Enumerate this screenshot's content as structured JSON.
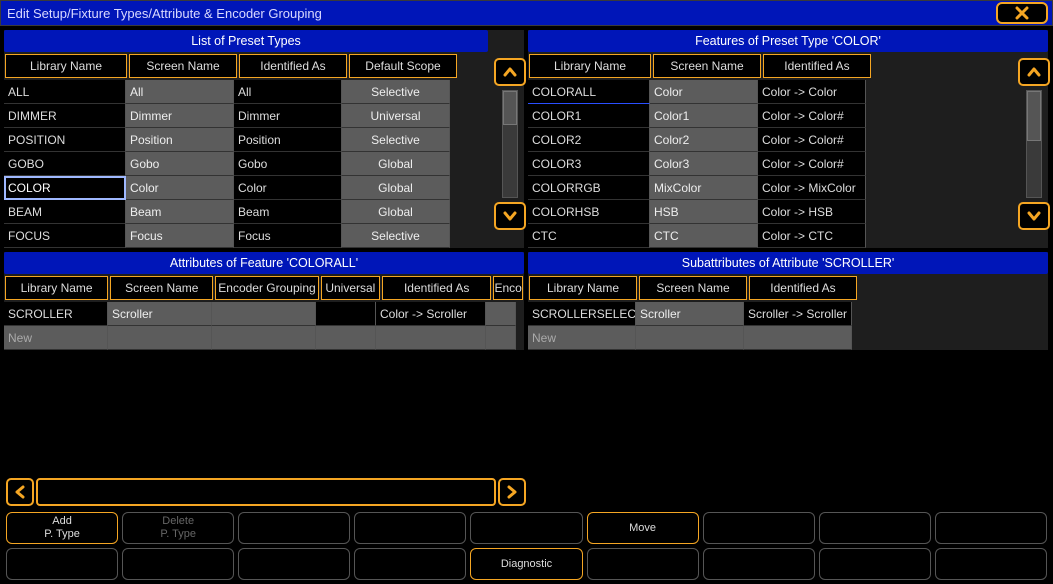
{
  "title": "Edit Setup/Fixture Types/Attribute & Encoder Grouping",
  "panels": {
    "presetTypes": {
      "title": "List of Preset Types",
      "headers": [
        "Library Name",
        "Screen Name",
        "Identified As",
        "Default Scope"
      ],
      "rows": [
        {
          "lib": "ALL",
          "screen": "All",
          "ident": "All",
          "scope": "Selective"
        },
        {
          "lib": "DIMMER",
          "screen": "Dimmer",
          "ident": "Dimmer",
          "scope": "Universal"
        },
        {
          "lib": "POSITION",
          "screen": "Position",
          "ident": "Position",
          "scope": "Selective"
        },
        {
          "lib": "GOBO",
          "screen": "Gobo",
          "ident": "Gobo",
          "scope": "Global"
        },
        {
          "lib": "COLOR",
          "screen": "Color",
          "ident": "Color",
          "scope": "Global"
        },
        {
          "lib": "BEAM",
          "screen": "Beam",
          "ident": "Beam",
          "scope": "Global"
        },
        {
          "lib": "FOCUS",
          "screen": "Focus",
          "ident": "Focus",
          "scope": "Selective"
        }
      ],
      "selectedRow": 4
    },
    "features": {
      "title": "Features of Preset Type 'COLOR'",
      "headers": [
        "Library Name",
        "Screen Name",
        "Identified As"
      ],
      "rows": [
        {
          "lib": "COLORALL",
          "screen": "Color",
          "ident": "Color -> Color"
        },
        {
          "lib": "COLOR1",
          "screen": "Color1",
          "ident": "Color -> Color#"
        },
        {
          "lib": "COLOR2",
          "screen": "Color2",
          "ident": "Color -> Color#"
        },
        {
          "lib": "COLOR3",
          "screen": "Color3",
          "ident": "Color -> Color#"
        },
        {
          "lib": "COLORRGB",
          "screen": "MixColor",
          "ident": "Color -> MixColor"
        },
        {
          "lib": "COLORHSB",
          "screen": "HSB",
          "ident": "Color -> HSB"
        },
        {
          "lib": "CTC",
          "screen": "CTC",
          "ident": "Color -> CTC"
        }
      ],
      "selectedRow": 0
    },
    "attributes": {
      "title": "Attributes of Feature 'COLORALL'",
      "headers": [
        "Library Name",
        "Screen Name",
        "Encoder Grouping",
        "Universal",
        "Identified As",
        "Encoder"
      ],
      "rows": [
        {
          "lib": "SCROLLER",
          "screen": "Scroller",
          "enc": "",
          "univ": "",
          "ident": "Color -> Scroller",
          "encoder": ""
        }
      ],
      "newLabel": "New"
    },
    "subattributes": {
      "title": "Subattributes of Attribute 'SCROLLER'",
      "headers": [
        "Library Name",
        "Screen Name",
        "Identified As"
      ],
      "rows": [
        {
          "lib": "SCROLLERSELECT",
          "screen": "Scroller",
          "ident": "Scroller -> Scroller"
        }
      ],
      "newLabel": "New"
    }
  },
  "bottom": {
    "buttons": {
      "add": {
        "l1": "Add",
        "l2": "P. Type"
      },
      "delete": {
        "l1": "Delete",
        "l2": "P. Type"
      },
      "diagnostic": {
        "l1": "Diagnostic"
      },
      "move": {
        "l1": "Move"
      }
    }
  }
}
